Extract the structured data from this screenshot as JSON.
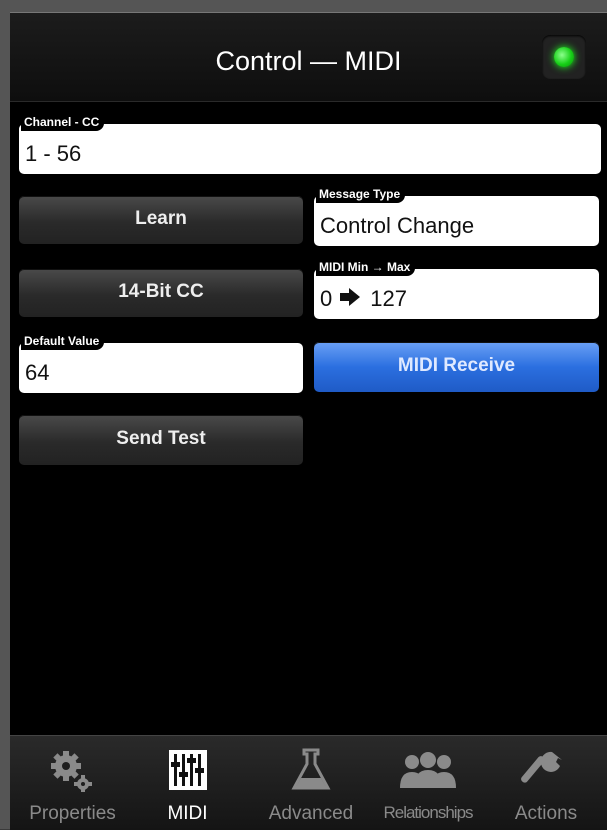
{
  "header": {
    "title": "Control — MIDI"
  },
  "fields": {
    "channel_cc": {
      "label": "Channel - CC",
      "value": "1 - 56"
    },
    "message_type": {
      "label": "Message Type",
      "value": "Control Change"
    },
    "midi_range": {
      "label": "MIDI Min → Max",
      "min": "0",
      "max": "127"
    },
    "default_value": {
      "label": "Default Value",
      "value": "64"
    }
  },
  "buttons": {
    "learn": "Learn",
    "cc14": "14-Bit CC",
    "midi_receive": "MIDI Receive",
    "send_test": "Send Test"
  },
  "tabs": [
    {
      "label": "Properties",
      "icon": "gears-icon"
    },
    {
      "label": "MIDI",
      "icon": "sliders-icon"
    },
    {
      "label": "Advanced",
      "icon": "flask-icon"
    },
    {
      "label": "Relationships",
      "icon": "people-icon"
    },
    {
      "label": "Actions",
      "icon": "wrench-icon"
    }
  ],
  "active_tab": "MIDI",
  "status": {
    "led_color": "#17d017"
  },
  "colors": {
    "accent_blue": "#2b6fe0",
    "background": "#000000"
  }
}
